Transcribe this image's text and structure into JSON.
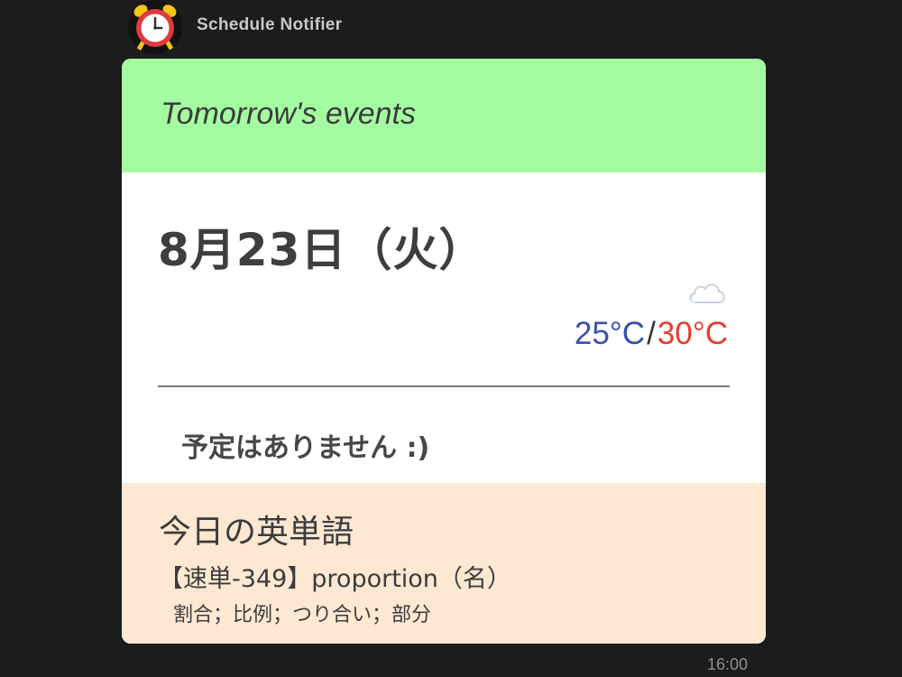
{
  "sender": {
    "name": "Schedule Notifier",
    "avatar_icon": "alarm-clock-icon"
  },
  "card": {
    "header": {
      "title": "Tomorrow's events",
      "background": "#a4fca1"
    },
    "date": "8月23日（火）",
    "weather": {
      "icon": "cloud-icon",
      "low": "25°C",
      "separator": "/",
      "high": "30°C",
      "low_color": "#3a4fae",
      "high_color": "#e53d30"
    },
    "no_events": "予定はありません :)",
    "footer": {
      "heading": "今日の英単語",
      "entry": "【速単-349】proportion（名）",
      "meaning": "割合；比例；つり合い；部分",
      "background": "#fde8d3"
    }
  },
  "timestamp": "16:00"
}
